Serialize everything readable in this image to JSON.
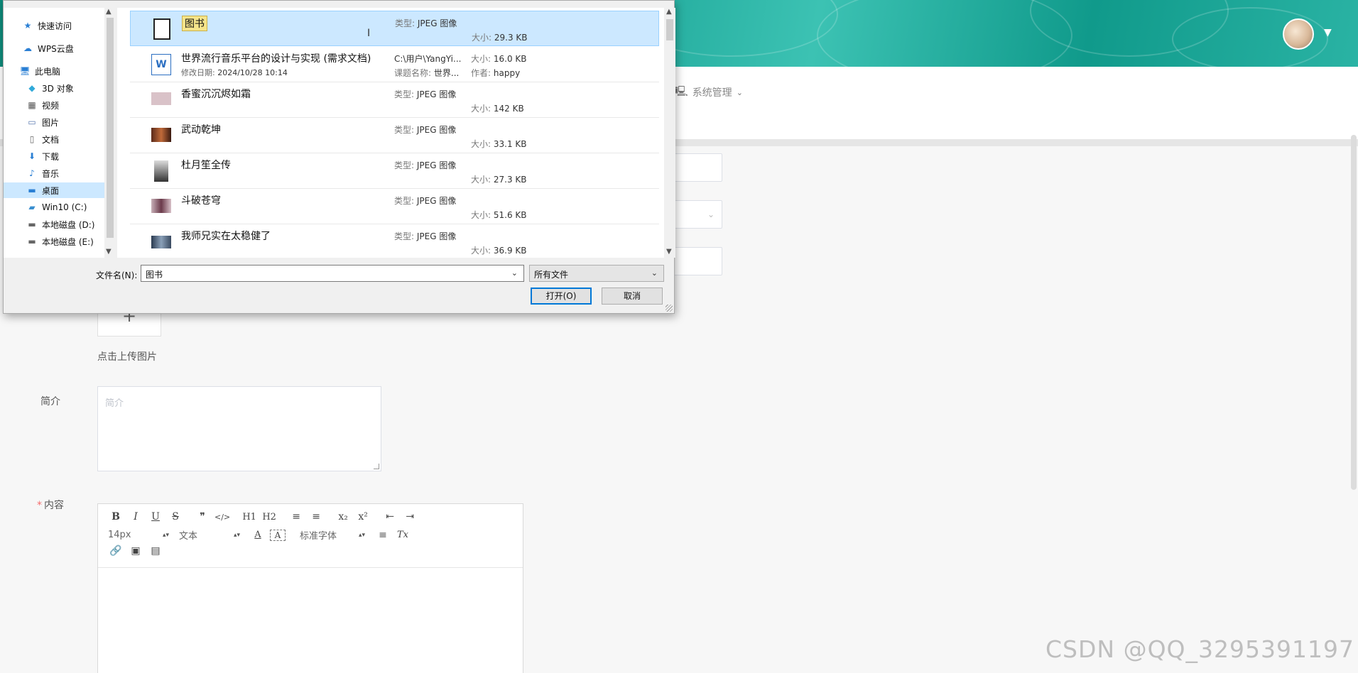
{
  "header": {
    "nav_system_label": "系统管理",
    "nav_system_icon": "computer-icon",
    "avatar_icon": "avatar-image"
  },
  "form": {
    "upload_hint": "点击上传图片",
    "upload_plus": "+",
    "intro_label": "简介",
    "intro_placeholder": "简介",
    "content_label": "内容",
    "content_required_mark": "*"
  },
  "editor": {
    "row1": [
      "B",
      "I",
      "U",
      "S",
      "❞",
      "</>",
      "H1",
      "H2",
      "≡",
      "≡",
      "x₂",
      "x²",
      "⇤",
      "⇥"
    ],
    "font_size": "14px",
    "block_type": "文本",
    "font_family": "标准字体",
    "row2_buttons": [
      "A",
      "A",
      "≡",
      "Tx"
    ],
    "row3_buttons": [
      "link-icon",
      "image-icon",
      "video-icon"
    ]
  },
  "watermark": "CSDN @QQ_3295391197",
  "dialog": {
    "nav": [
      {
        "label": "快速访问",
        "icon": "star-icon"
      },
      {
        "label": "WPS云盘",
        "icon": "cloud-icon"
      },
      {
        "label": "此电脑",
        "icon": "computer-icon"
      },
      {
        "label": "3D 对象",
        "icon": "cube-icon"
      },
      {
        "label": "视频",
        "icon": "video-icon"
      },
      {
        "label": "图片",
        "icon": "picture-icon"
      },
      {
        "label": "文档",
        "icon": "document-icon"
      },
      {
        "label": "下载",
        "icon": "download-icon"
      },
      {
        "label": "音乐",
        "icon": "music-icon"
      },
      {
        "label": "桌面",
        "icon": "desktop-icon",
        "selected": true
      },
      {
        "label": "Win10 (C:)",
        "icon": "drive-icon"
      },
      {
        "label": "本地磁盘 (D:)",
        "icon": "drive-icon"
      },
      {
        "label": "本地磁盘 (E:)",
        "icon": "drive-icon"
      }
    ],
    "files": [
      {
        "name": "图书",
        "type_key": "类型:",
        "type": "JPEG 图像",
        "size_key": "大小:",
        "size": "29.3 KB",
        "selected": true,
        "thumb": "#ffffff"
      },
      {
        "name": "世界流行音乐平台的设计与实现 (需求文档)",
        "modified_key": "修改日期:",
        "modified": "2024/10/28 10:14",
        "path": "C:\\用户\\YangYi...",
        "subject_key": "课题名称:",
        "subject": "世界...",
        "size_key": "大小:",
        "size": "16.0 KB",
        "author_key": "作者:",
        "author": "happy",
        "doc": true
      },
      {
        "name": "香蜜沉沉烬如霜",
        "type_key": "类型:",
        "type": "JPEG 图像",
        "size_key": "大小:",
        "size": "142 KB",
        "thumb": "#d9c2c8"
      },
      {
        "name": "武动乾坤",
        "type_key": "类型:",
        "type": "JPEG 图像",
        "size_key": "大小:",
        "size": "33.1 KB",
        "thumb": "#8a4a2a"
      },
      {
        "name": "杜月笙全传",
        "type_key": "类型:",
        "type": "JPEG 图像",
        "size_key": "大小:",
        "size": "27.3 KB",
        "thumb": "#4a4a4a"
      },
      {
        "name": "斗破苍穹",
        "type_key": "类型:",
        "type": "JPEG 图像",
        "size_key": "大小:",
        "size": "51.6 KB",
        "thumb": "#9a7080"
      },
      {
        "name": "我师兄实在太稳健了",
        "type_key": "类型:",
        "type": "JPEG 图像",
        "size_key": "大小:",
        "size": "36.9 KB",
        "thumb": "#6a7a90"
      }
    ],
    "filename_label": "文件名(N):",
    "filename_value": "图书",
    "filetype_value": "所有文件",
    "open_label": "打开(O)",
    "cancel_label": "取消"
  }
}
